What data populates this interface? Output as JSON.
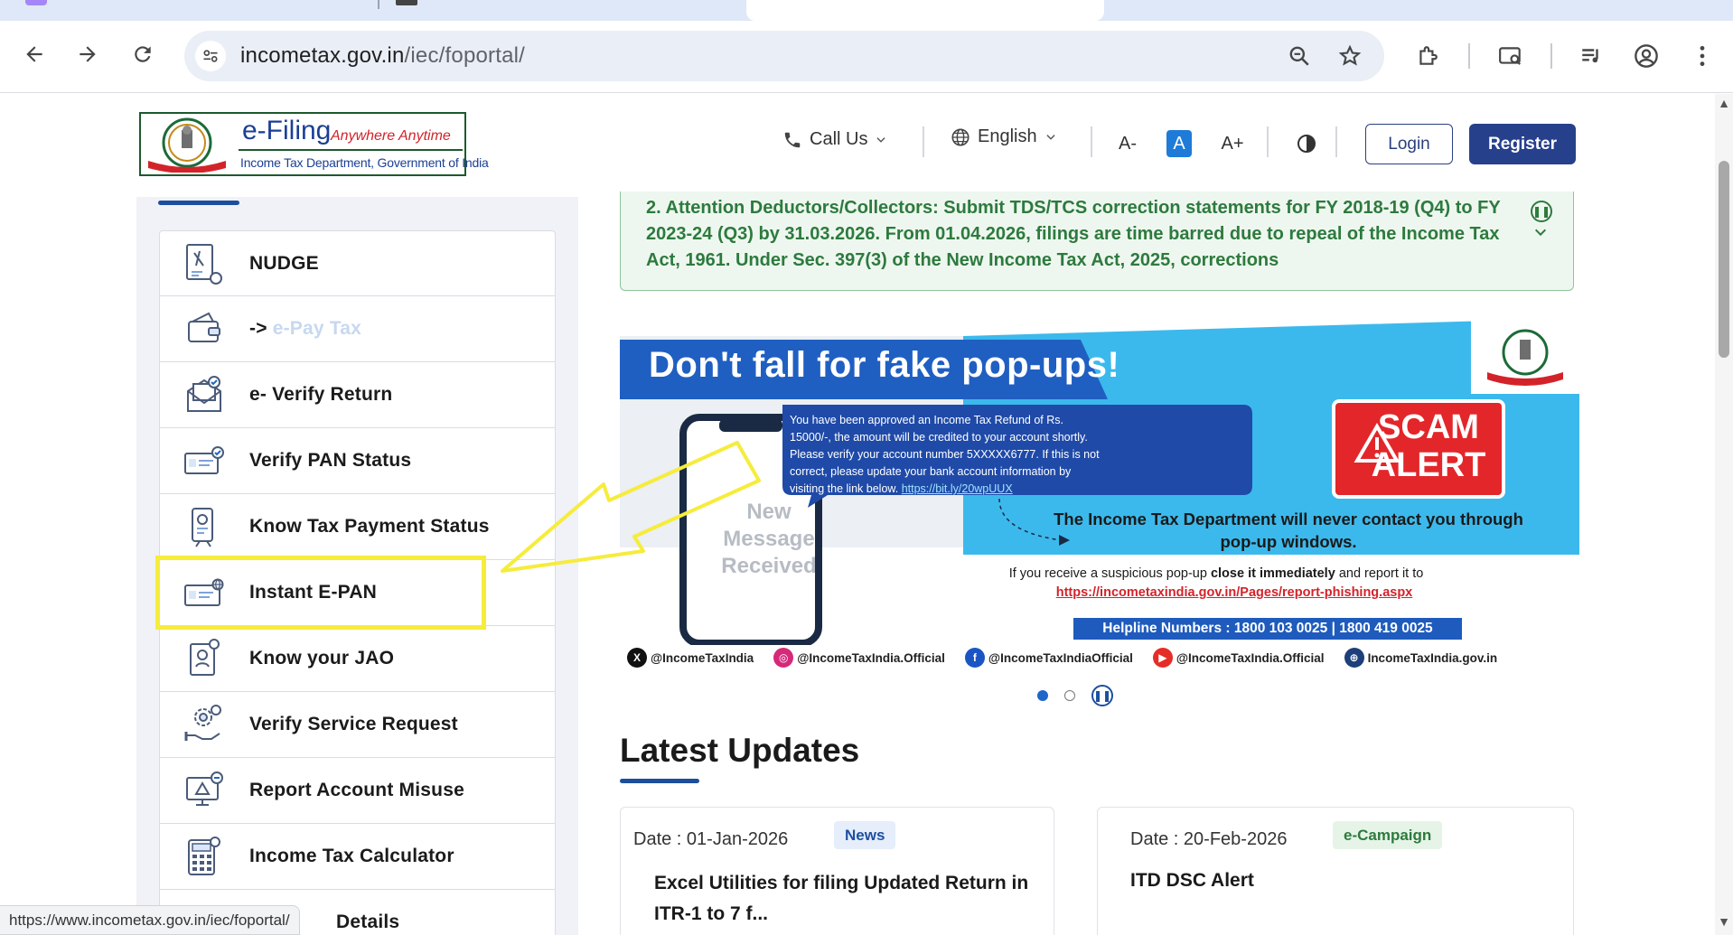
{
  "browser": {
    "url_host": "incometax.gov.in",
    "url_path": "/iec/foportal/",
    "status_url": "https://www.incometax.gov.in/iec/foportal/"
  },
  "header": {
    "logo_title": "e-Filing",
    "logo_tagline": "Anywhere Anytime",
    "logo_subtitle": "Income Tax Department, Government of India",
    "call_us": "Call Us",
    "language": "English",
    "font_decrease": "A-",
    "font_default": "A",
    "font_increase": "A+",
    "login": "Login",
    "register": "Register"
  },
  "sidebar": {
    "items": [
      {
        "label": "NUDGE",
        "icon": "nudge-icon"
      },
      {
        "label_prefix": "->",
        "label": "e-Pay Tax",
        "icon": "wallet-icon"
      },
      {
        "label": "e- Verify Return",
        "icon": "envelope-check-icon"
      },
      {
        "label": "Verify PAN Status",
        "icon": "pan-card-check-icon"
      },
      {
        "label": "Know Tax Payment Status",
        "icon": "phone-receipt-icon"
      },
      {
        "label": "Instant E-PAN",
        "icon": "pan-card-globe-icon"
      },
      {
        "label": "Know your JAO",
        "icon": "officer-document-icon"
      },
      {
        "label": "Verify Service Request",
        "icon": "gear-hand-icon"
      },
      {
        "label": "Report Account Misuse",
        "icon": "monitor-alert-icon"
      },
      {
        "label": "Income Tax Calculator",
        "icon": "calculator-icon"
      },
      {
        "label": "Details",
        "icon": "details-icon"
      }
    ]
  },
  "notice": {
    "text": "2.  Attention Deductors/Collectors: Submit TDS/TCS correction statements for FY 2018-19 (Q4) to FY 2023-24 (Q3) by 31.03.2026. From 01.04.2026, filings are time barred due to repeal of the Income Tax Act, 1961. Under Sec. 397(3) of the New Income Tax Act, 2025, corrections"
  },
  "banner": {
    "headline": "Don't fall for fake pop-ups!",
    "popup_text": "You have been approved an Income Tax Refund of Rs. 15000/-, the amount will be credited to your account shortly. Please verify your account number 5XXXXX6777. If this is not correct, please update your bank account information by visiting the link below.",
    "popup_link": "https://bit.ly/20wpUUX",
    "phone_text": "New Message Received",
    "scam_line1": "SCAM",
    "scam_line2": "ALERT",
    "never_contact": "The Income Tax Department will never contact you through pop-up windows.",
    "if_you_prefix": "If you receive a suspicious pop-up",
    "if_you_bold": "close it immediately",
    "if_you_suffix": "and report it to",
    "phishing_link": "https://incometaxindia.gov.in/Pages/report-phishing.aspx",
    "helpline": "Helpline Numbers : 1800 103 0025 | 1800 419 0025",
    "socials": [
      {
        "icon": "x-icon",
        "handle": "@IncomeTaxIndia",
        "color": "#111111"
      },
      {
        "icon": "instagram-icon",
        "handle": "@IncomeTaxIndia.Official",
        "color": "#d6297a"
      },
      {
        "icon": "facebook-icon",
        "handle": "@IncomeTaxIndiaOfficial",
        "color": "#1b55c4"
      },
      {
        "icon": "youtube-icon",
        "handle": "@IncomeTaxIndia.Official",
        "color": "#e52d27"
      },
      {
        "icon": "globe-icon",
        "handle": "IncomeTaxIndia.gov.in",
        "color": "#1d3f7a"
      }
    ]
  },
  "latest_updates": {
    "title": "Latest Updates",
    "cards": [
      {
        "date": "Date : 01-Jan-2026",
        "badge": "News",
        "title": "Excel Utilities for filing Updated Return in ITR-1 to 7 f..."
      },
      {
        "date": "Date : 20-Feb-2026",
        "badge": "e-Campaign",
        "title": "ITD DSC Alert"
      }
    ]
  },
  "colors": {
    "brand_blue": "#27408b",
    "accent_blue": "#1d4e9c",
    "notice_green": "#2d7a3e",
    "banner_blue": "#1e5bbd",
    "banner_sky": "#3cb9ec",
    "scam_red": "#e3262a",
    "highlight_yellow": "#f6ec3c"
  }
}
